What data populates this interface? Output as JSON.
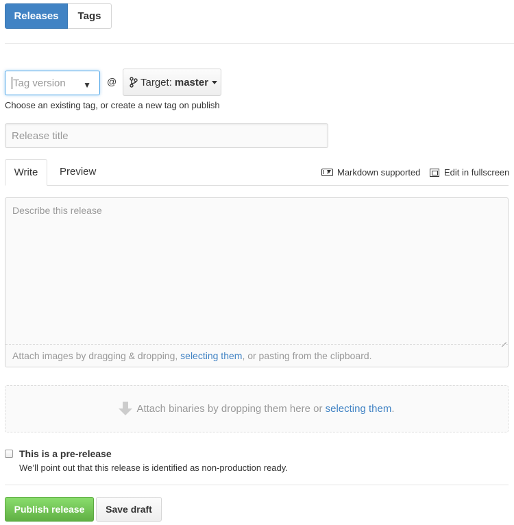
{
  "tabs": {
    "releases": "Releases",
    "tags": "Tags",
    "active": "Releases"
  },
  "tag": {
    "placeholder": "Tag version",
    "dropdown_icon": "triangle-down-icon"
  },
  "at_symbol": "@",
  "target": {
    "icon": "git-branch-icon",
    "label": "Target:",
    "value": "master"
  },
  "tag_hint": "Choose an existing tag, or create a new tag on publish",
  "release_title": {
    "placeholder": "Release title"
  },
  "editor": {
    "tab_write": "Write",
    "tab_preview": "Preview",
    "active_tab": "Write",
    "markdown_supported": "Markdown supported",
    "markdown_icon": "markdown-icon",
    "fullscreen": "Edit in fullscreen",
    "fullscreen_icon": "screen-full-icon",
    "placeholder": "Describe this release",
    "attach_prefix": "Attach images by dragging & dropping, ",
    "attach_link": "selecting them",
    "attach_suffix": ", or pasting from the clipboard."
  },
  "binaries": {
    "icon": "arrow-down-icon",
    "prefix": "Attach binaries by dropping them here or ",
    "link": "selecting them",
    "suffix": "."
  },
  "prerelease": {
    "checked": false,
    "label": "This is a pre-release",
    "note": "We’ll point out that this release is identified as non-production ready."
  },
  "actions": {
    "publish": "Publish release",
    "save_draft": "Save draft"
  },
  "colors": {
    "accent_blue": "#4183c4",
    "publish_green": "#6cc644",
    "link": "#4183c4"
  }
}
